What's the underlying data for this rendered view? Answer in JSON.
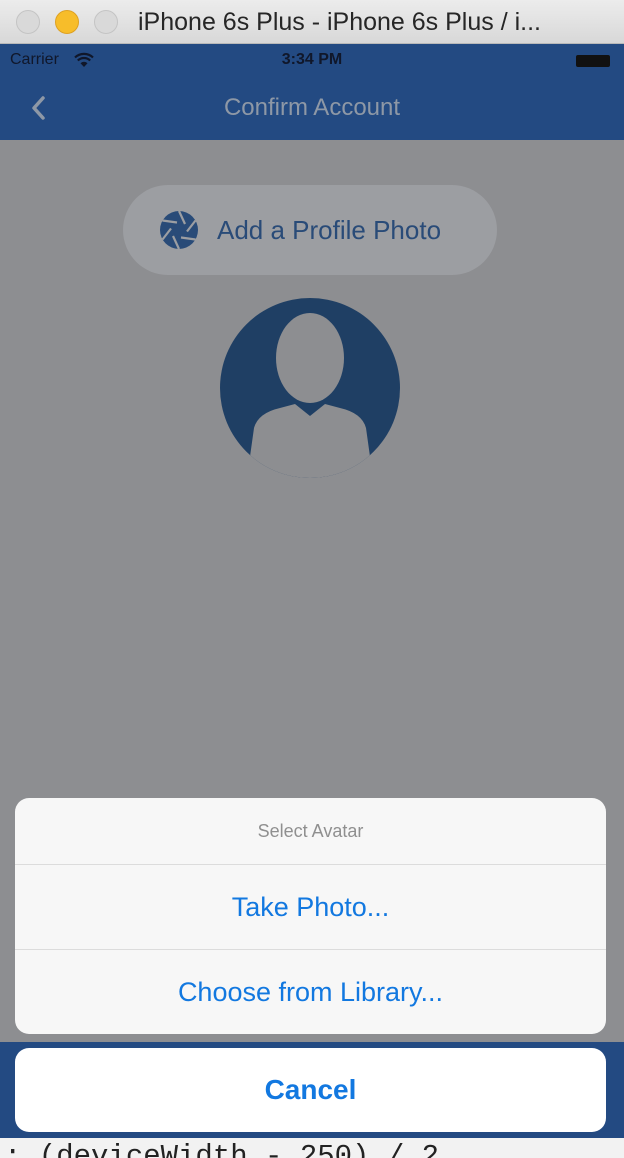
{
  "window": {
    "title": "iPhone 6s Plus - iPhone 6s Plus / i..."
  },
  "status_bar": {
    "carrier": "Carrier",
    "time": "3:34 PM"
  },
  "nav": {
    "title": "Confirm Account"
  },
  "profile": {
    "add_photo_label": "Add a Profile Photo"
  },
  "action_sheet": {
    "title": "Select Avatar",
    "options": [
      "Take Photo...",
      "Choose from Library..."
    ],
    "cancel_label": "Cancel"
  },
  "code_editor": {
    "visible_text": ": (deviceWidth - 250) / 2,"
  },
  "colors": {
    "nav_blue": "#234a82",
    "action_blue": "#1278e0",
    "overlay_gray": "#8d8e91"
  },
  "icons": [
    "wifi-icon",
    "battery-icon",
    "back-chevron-icon",
    "camera-aperture-icon",
    "avatar-placeholder-icon"
  ]
}
